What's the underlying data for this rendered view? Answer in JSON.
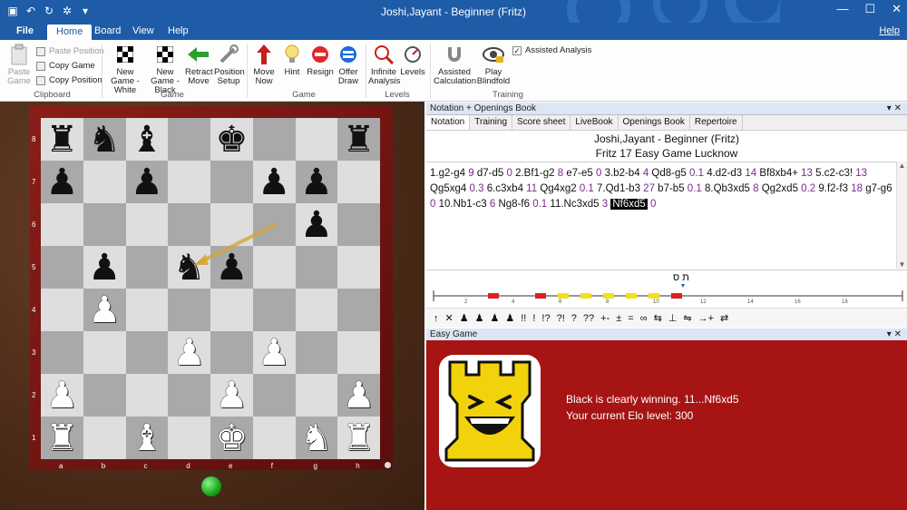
{
  "window": {
    "title": "Joshi,Jayant - Beginner (Fritz)",
    "menu_tabs": [
      "File",
      "Home",
      "Board",
      "View",
      "Help"
    ],
    "help_link": "Help"
  },
  "ribbon": {
    "clipboard": {
      "label": "Clipboard",
      "paste": "Paste Game",
      "paste_position": "Paste Position",
      "copy_game": "Copy Game",
      "copy_position": "Copy Position"
    },
    "game": {
      "label": "Game",
      "new_white": "New Game - White",
      "new_black": "New Game - Black",
      "retract": "Retract Move",
      "position_setup": "Position Setup"
    },
    "game2": {
      "label": "Game",
      "move_now": "Move Now",
      "hint": "Hint",
      "resign": "Resign",
      "offer_draw": "Offer Draw"
    },
    "levels": {
      "label": "Levels",
      "infinite": "Infinite Analysis",
      "levels": "Levels"
    },
    "training": {
      "label": "Training",
      "assisted_calc": "Assisted Calculation",
      "play_blindfold": "Play Blindfold",
      "assisted_analysis": "Assisted Analysis",
      "assisted_analysis_checked": true
    }
  },
  "board": {
    "ranks": [
      "8",
      "7",
      "6",
      "5",
      "4",
      "3",
      "2",
      "1"
    ],
    "files": [
      "a",
      "b",
      "c",
      "d",
      "e",
      "f",
      "g",
      "h"
    ],
    "position": [
      [
        "bR",
        "bN",
        "bB",
        "",
        "bK",
        "",
        "",
        "bR"
      ],
      [
        "bP",
        "",
        "bP",
        "",
        "",
        "bP",
        "bP",
        ""
      ],
      [
        "",
        "",
        "",
        "",
        "",
        "",
        "bP",
        ""
      ],
      [
        "",
        "bP",
        "",
        "bN",
        "bP",
        "",
        "",
        ""
      ],
      [
        "",
        "wP",
        "",
        "",
        "",
        "",
        "",
        ""
      ],
      [
        "",
        "",
        "",
        "wP",
        "",
        "wP",
        "",
        ""
      ],
      [
        "wP",
        "",
        "",
        "",
        "wP",
        "",
        "",
        "wP"
      ],
      [
        "wR",
        "",
        "wB",
        "",
        "wK",
        "",
        "wN",
        "wR"
      ]
    ],
    "last_move_arrow": {
      "from": "f6",
      "to": "d5",
      "color": "#d4a534"
    }
  },
  "notation_panel": {
    "header": "Notation + Openings Book",
    "tabs": [
      "Notation",
      "Training",
      "Score sheet",
      "LiveBook",
      "Openings Book",
      "Repertoire"
    ],
    "game_title": "Joshi,Jayant - Beginner (Fritz)",
    "game_event": "Fritz 17 Easy Game Lucknow",
    "moves": [
      {
        "t": "1.g2-g4",
        "e": "9"
      },
      {
        "t": "d7-d5",
        "e": "0"
      },
      {
        "t": "2.Bf1-g2",
        "e": "8"
      },
      {
        "t": "e7-e5",
        "e": "0"
      },
      {
        "t": "3.b2-b4",
        "e": "4"
      },
      {
        "t": "Qd8-g5",
        "e": "0.1"
      },
      {
        "t": "4.d2-d3",
        "e": "14"
      },
      {
        "t": "Bf8xb4+",
        "e": "13"
      },
      {
        "t": "5.c2-c3!",
        "e": "13"
      },
      {
        "t": "Qg5xg4",
        "e": "0.3"
      },
      {
        "t": "6.c3xb4",
        "e": "11"
      },
      {
        "t": "Qg4xg2",
        "e": "0.1"
      },
      {
        "t": "7.Qd1-b3",
        "e": "27"
      },
      {
        "t": "b7-b5",
        "e": "0.1"
      },
      {
        "t": "8.Qb3xd5",
        "e": "8"
      },
      {
        "t": "Qg2xd5",
        "e": "0.2"
      },
      {
        "t": "9.f2-f3",
        "e": "18"
      },
      {
        "t": "g7-g6",
        "e": "0"
      },
      {
        "t": "10.Nb1-c3",
        "e": "6"
      },
      {
        "t": "Ng8-f6",
        "e": "0.1"
      },
      {
        "t": "11.Nc3xd5",
        "e": "3"
      },
      {
        "t": "Nf6xd5",
        "e": "0",
        "current": true
      }
    ],
    "eval_marker": "ת ס",
    "eval_ticks": [
      "2",
      "4",
      "6",
      "8",
      "10",
      "12",
      "14",
      "16",
      "18"
    ],
    "symbols": [
      "↑",
      "✕",
      "♟",
      "♟",
      "♟",
      "♟",
      "!!",
      "!",
      "!?",
      "?!",
      "?",
      "??",
      "+-",
      "±",
      "=",
      "∞",
      "⇆",
      "⊥",
      "⇋",
      "→+",
      "⇄"
    ]
  },
  "easy_game": {
    "header": "Easy Game",
    "status": "Black is clearly winning.  11...Nf6xd5",
    "elo": "Your current Elo level: 300"
  }
}
